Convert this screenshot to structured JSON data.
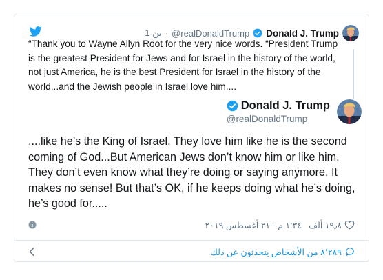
{
  "quoted_tweet": {
    "display_name": "Donald J. Trump",
    "handle": "@realDonaldTrump",
    "separator": "·",
    "time": "1 ين",
    "text": "“Thank you to Wayne Allyn Root for the very nice words. “President Trump is the greatest President for Jews and for Israel in the history of the world, not just America, he is the best President for Israel in the history of the world...and the Jewish people in Israel love him...."
  },
  "main_tweet": {
    "display_name": "Donald J. Trump",
    "handle": "@realDonaldTrump",
    "text": "....like he’s the King of Israel. They love him like he is the second coming of God...But American Jews don’t know him or like him. They don’t even know what they’re doing or saying anymore. It makes no sense! But that’s OK, if he keeps doing what he’s doing, he’s good for.....",
    "timestamp": "١:٣٤ م - ٢١ أغسطس ٢٠١٩",
    "likes": "١٩٫٨ ألف"
  },
  "footer": {
    "replies_label": "٨٬٢٨٩ من الأشخاص يتحدثون عن ذلك"
  },
  "icons": {
    "brand": "twitter-bird-icon",
    "verified": "verified-badge-icon",
    "info": "info-icon",
    "like": "heart-icon",
    "back": "chevron-left-icon",
    "reply": "speech-bubble-icon"
  },
  "colors": {
    "twitter_blue": "#1da1f2",
    "link_blue": "#1b95e0",
    "secondary_text": "#657786",
    "border": "#e1e8ed"
  }
}
